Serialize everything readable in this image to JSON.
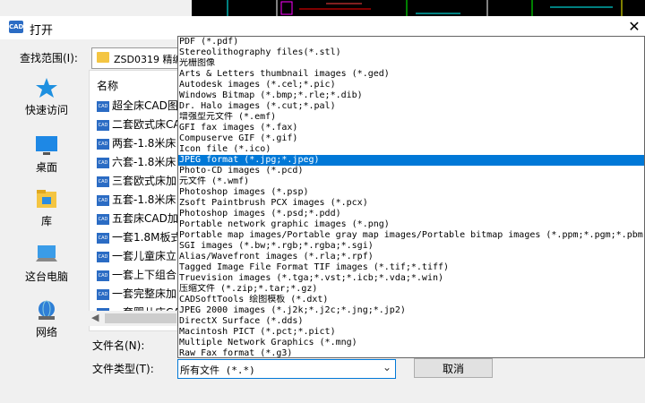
{
  "window": {
    "title": "打开",
    "app_icon": "CAD",
    "close_glyph": "✕"
  },
  "lookin": {
    "label": "查找范围(I):",
    "folder_name": "ZSD0319   精编"
  },
  "places": [
    {
      "label": "快速访问",
      "icon": "star-icon"
    },
    {
      "label": "桌面",
      "icon": "desktop-icon"
    },
    {
      "label": "库",
      "icon": "library-icon"
    },
    {
      "label": "这台电脑",
      "icon": "computer-icon"
    },
    {
      "label": "网络",
      "icon": "network-icon"
    }
  ],
  "filelist": {
    "header": "名称",
    "items": [
      "超全床CAD图",
      "二套欧式床CA",
      "两套-1.8米床",
      "六套-1.8米床",
      "三套欧式床加",
      "五套-1.8米床",
      "五套床CAD加",
      "一套1.8M板式",
      "一套儿童床立",
      "一套上下组合",
      "一套完整床加",
      "一套婴儿床CA"
    ]
  },
  "filename": {
    "label": "文件名(N):",
    "value": ""
  },
  "filetype": {
    "label": "文件类型(T):",
    "value": "所有文件 (*.*)",
    "options": [
      "PDF (*.pdf)",
      "Stereolithography files(*.stl)",
      "光栅图像",
      "Arts & Letters thumbnail images (*.ged)",
      "Autodesk images (*.cel;*.pic)",
      "Windows Bitmap (*.bmp;*.rle;*.dib)",
      "Dr. Halo images (*.cut;*.pal)",
      "增强型元文件 (*.emf)",
      "GFI fax images (*.fax)",
      "Compuserve GIF (*.gif)",
      "Icon file (*.ico)",
      "JPEG format (*.jpg;*.jpeg)",
      "Photo-CD images (*.pcd)",
      "元文件 (*.wmf)",
      "Photoshop images (*.psp)",
      "Zsoft Paintbrush PCX images (*.pcx)",
      "Photoshop images (*.psd;*.pdd)",
      "Portable network graphic images (*.png)",
      "Portable map images/Portable gray map images/Portable bitmap images (*.ppm;*.pgm;*.pbm)",
      "SGI images (*.bw;*.rgb;*.rgba;*.sgi)",
      "Alias/Wavefront images (*.rla;*.rpf)",
      "Tagged Image File Format TIF images (*.tif;*.tiff)",
      "Truevision images (*.tga;*.vst;*.icb;*.vda;*.win)",
      "压缩文件 (*.zip;*.tar;*.gz)",
      "CADSoftTools 绘图模板 (*.dxt)",
      "JPEG 2000 images (*.j2k;*.j2c;*.jng;*.jp2)",
      "DirectX Surface (*.dds)",
      "Macintosh PICT (*.pct;*.pict)",
      "Multiple Network Graphics (*.mng)",
      "Raw Fax format (*.g3)"
    ],
    "selected_index": 11
  },
  "buttons": {
    "cancel": "取消"
  },
  "colors": {
    "selection": "#0078d7",
    "accent": "#2b6cc4"
  }
}
